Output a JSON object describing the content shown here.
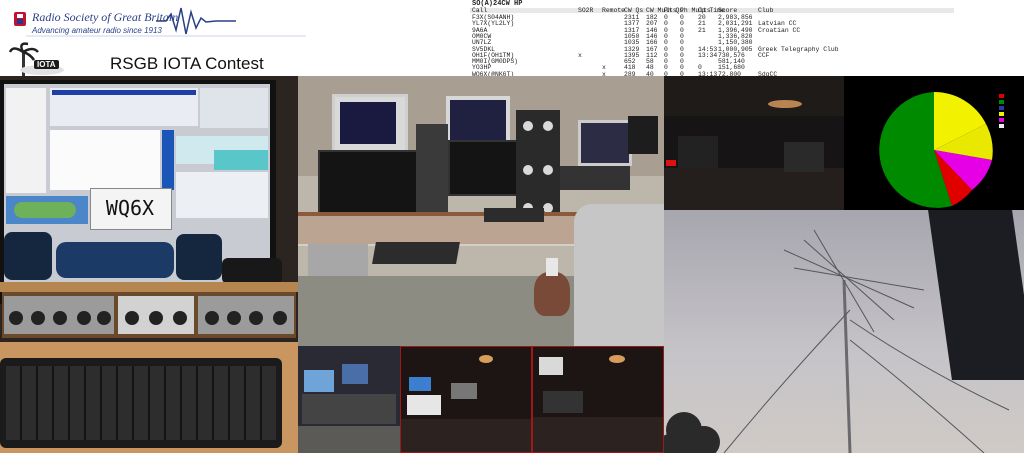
{
  "header": {
    "org_name": "Radio Society of Great Britain",
    "org_tagline": "Advancing amateur radio since 1913",
    "title": "RSGB IOTA Contest",
    "iota_logo_text": "IOTA"
  },
  "scoreboard": {
    "heading": "SO(A)24CW HP",
    "columns": [
      "Call",
      "SO2R",
      "Remote",
      "CW Qs",
      "CW Mults",
      "Ph Qs",
      "Ph Mults",
      "Op Time",
      "Score",
      "Club"
    ],
    "rows": [
      [
        "F3X(S04ANH)",
        "",
        "",
        "2311",
        "182",
        "0",
        "0",
        "20",
        "2,983,856",
        ""
      ],
      [
        "YL7X(YL2LY)",
        "",
        "",
        "1377",
        "207",
        "0",
        "0",
        "21",
        "2,031,291",
        "Latvian CC"
      ],
      [
        "9A6A",
        "",
        "",
        "1317",
        "146",
        "0",
        "0",
        "21",
        "1,396,490",
        "Croatian CC"
      ],
      [
        "OM0CW",
        "",
        "",
        "1050",
        "146",
        "0",
        "0",
        "",
        "1,336,820",
        ""
      ],
      [
        "UN7LZ",
        "",
        "",
        "1035",
        "166",
        "0",
        "0",
        "",
        "1,150,380",
        ""
      ],
      [
        "SV5DKL",
        "",
        "",
        "1329",
        "167",
        "0",
        "0",
        "14:53",
        "1,000,905",
        "Greek Telegraphy Club"
      ],
      [
        "OH1F(OH1TM)",
        "x",
        "",
        "1395",
        "112",
        "0",
        "0",
        "13:34",
        "730,576",
        "CCF"
      ],
      [
        "MM0I(GM0DPS)",
        "",
        "",
        "652",
        "58",
        "0",
        "0",
        "",
        "581,140",
        ""
      ],
      [
        "YO3HP",
        "",
        "x",
        "418",
        "48",
        "0",
        "0",
        "0",
        "151,680",
        ""
      ],
      [
        "WQ6X(@NK6T)",
        "",
        "x",
        "289",
        "40",
        "0",
        "0",
        "13:13",
        "72,800",
        "SdgCC"
      ]
    ]
  },
  "screen_label": "WQ6X"
}
